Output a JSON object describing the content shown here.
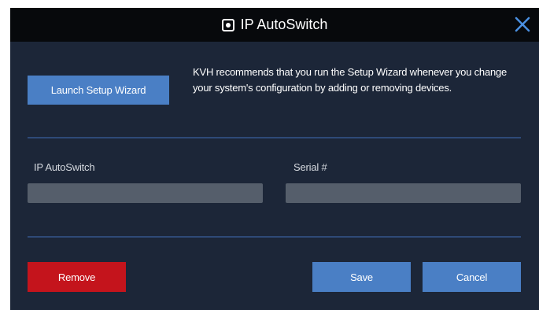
{
  "dialog": {
    "title": "IP AutoSwitch",
    "title_icon": "ip-autoswitch-icon",
    "close_icon": "close-icon"
  },
  "wizard": {
    "launch_label": "Launch Setup Wizard",
    "description": "KVH recommends that you run the Setup Wizard whenever you change your system's configuration by adding or removing devices."
  },
  "fields": {
    "autoswitch_label": "IP AutoSwitch",
    "autoswitch_value": "",
    "serial_label": "Serial #",
    "serial_value": ""
  },
  "actions": {
    "remove_label": "Remove",
    "save_label": "Save",
    "cancel_label": "Cancel"
  },
  "colors": {
    "background": "#1c2638",
    "title_bar": "#07090c",
    "accent_blue": "#4a7fc5",
    "danger_red": "#c4141c",
    "close_icon": "#4a90e2",
    "input_fill": "#555e6b",
    "divider": "#2e4a78"
  }
}
